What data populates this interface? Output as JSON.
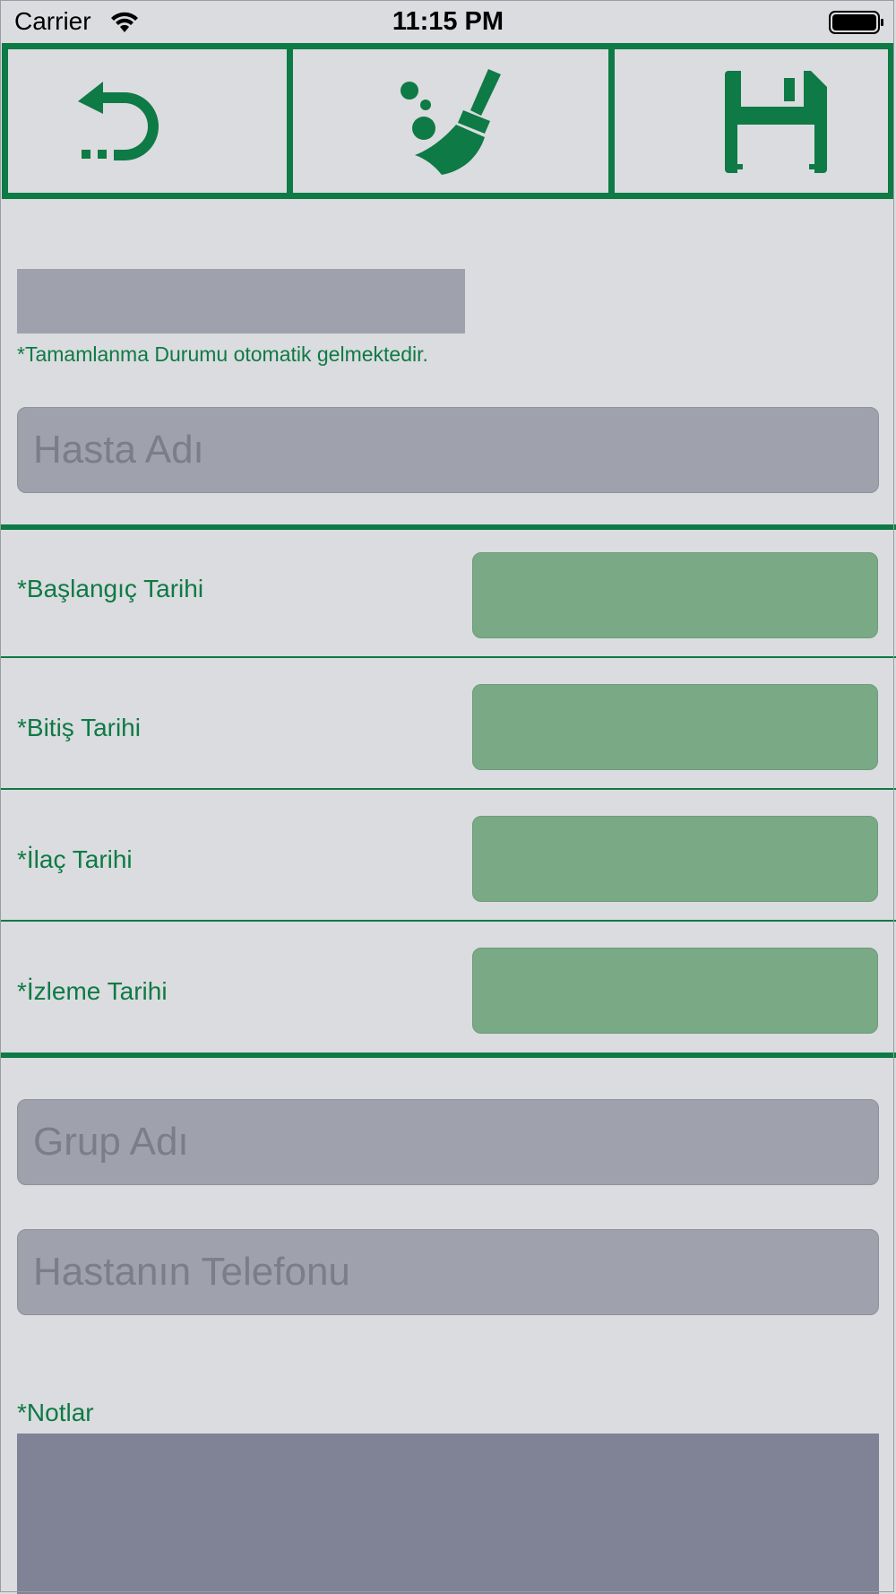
{
  "status_bar": {
    "carrier": "Carrier",
    "time": "11:15 PM"
  },
  "toolbar": {
    "buttons": [
      {
        "icon": "undo-arrow-icon"
      },
      {
        "icon": "broom-clean-icon"
      },
      {
        "icon": "floppy-disk-save-icon"
      }
    ]
  },
  "form": {
    "completion_note": "*Tamamlanma Durumu otomatik gelmektedir.",
    "patient_name_placeholder": "Hasta Adı",
    "dates": [
      {
        "label": "*Başlangıç Tarihi"
      },
      {
        "label": "*Bitiş Tarihi"
      },
      {
        "label": "*İlaç Tarihi"
      },
      {
        "label": "*İzleme Tarihi"
      }
    ],
    "group_name_placeholder": "Grup Adı",
    "patient_phone_placeholder": "Hastanın Telefonu",
    "notes_label": "*Notlar"
  },
  "colors": {
    "accent": "#0e7a45",
    "field_gray": "#9fa1ac",
    "date_green": "#7aa986",
    "notes_bg": "#808396",
    "background": "#dbdcdf"
  }
}
